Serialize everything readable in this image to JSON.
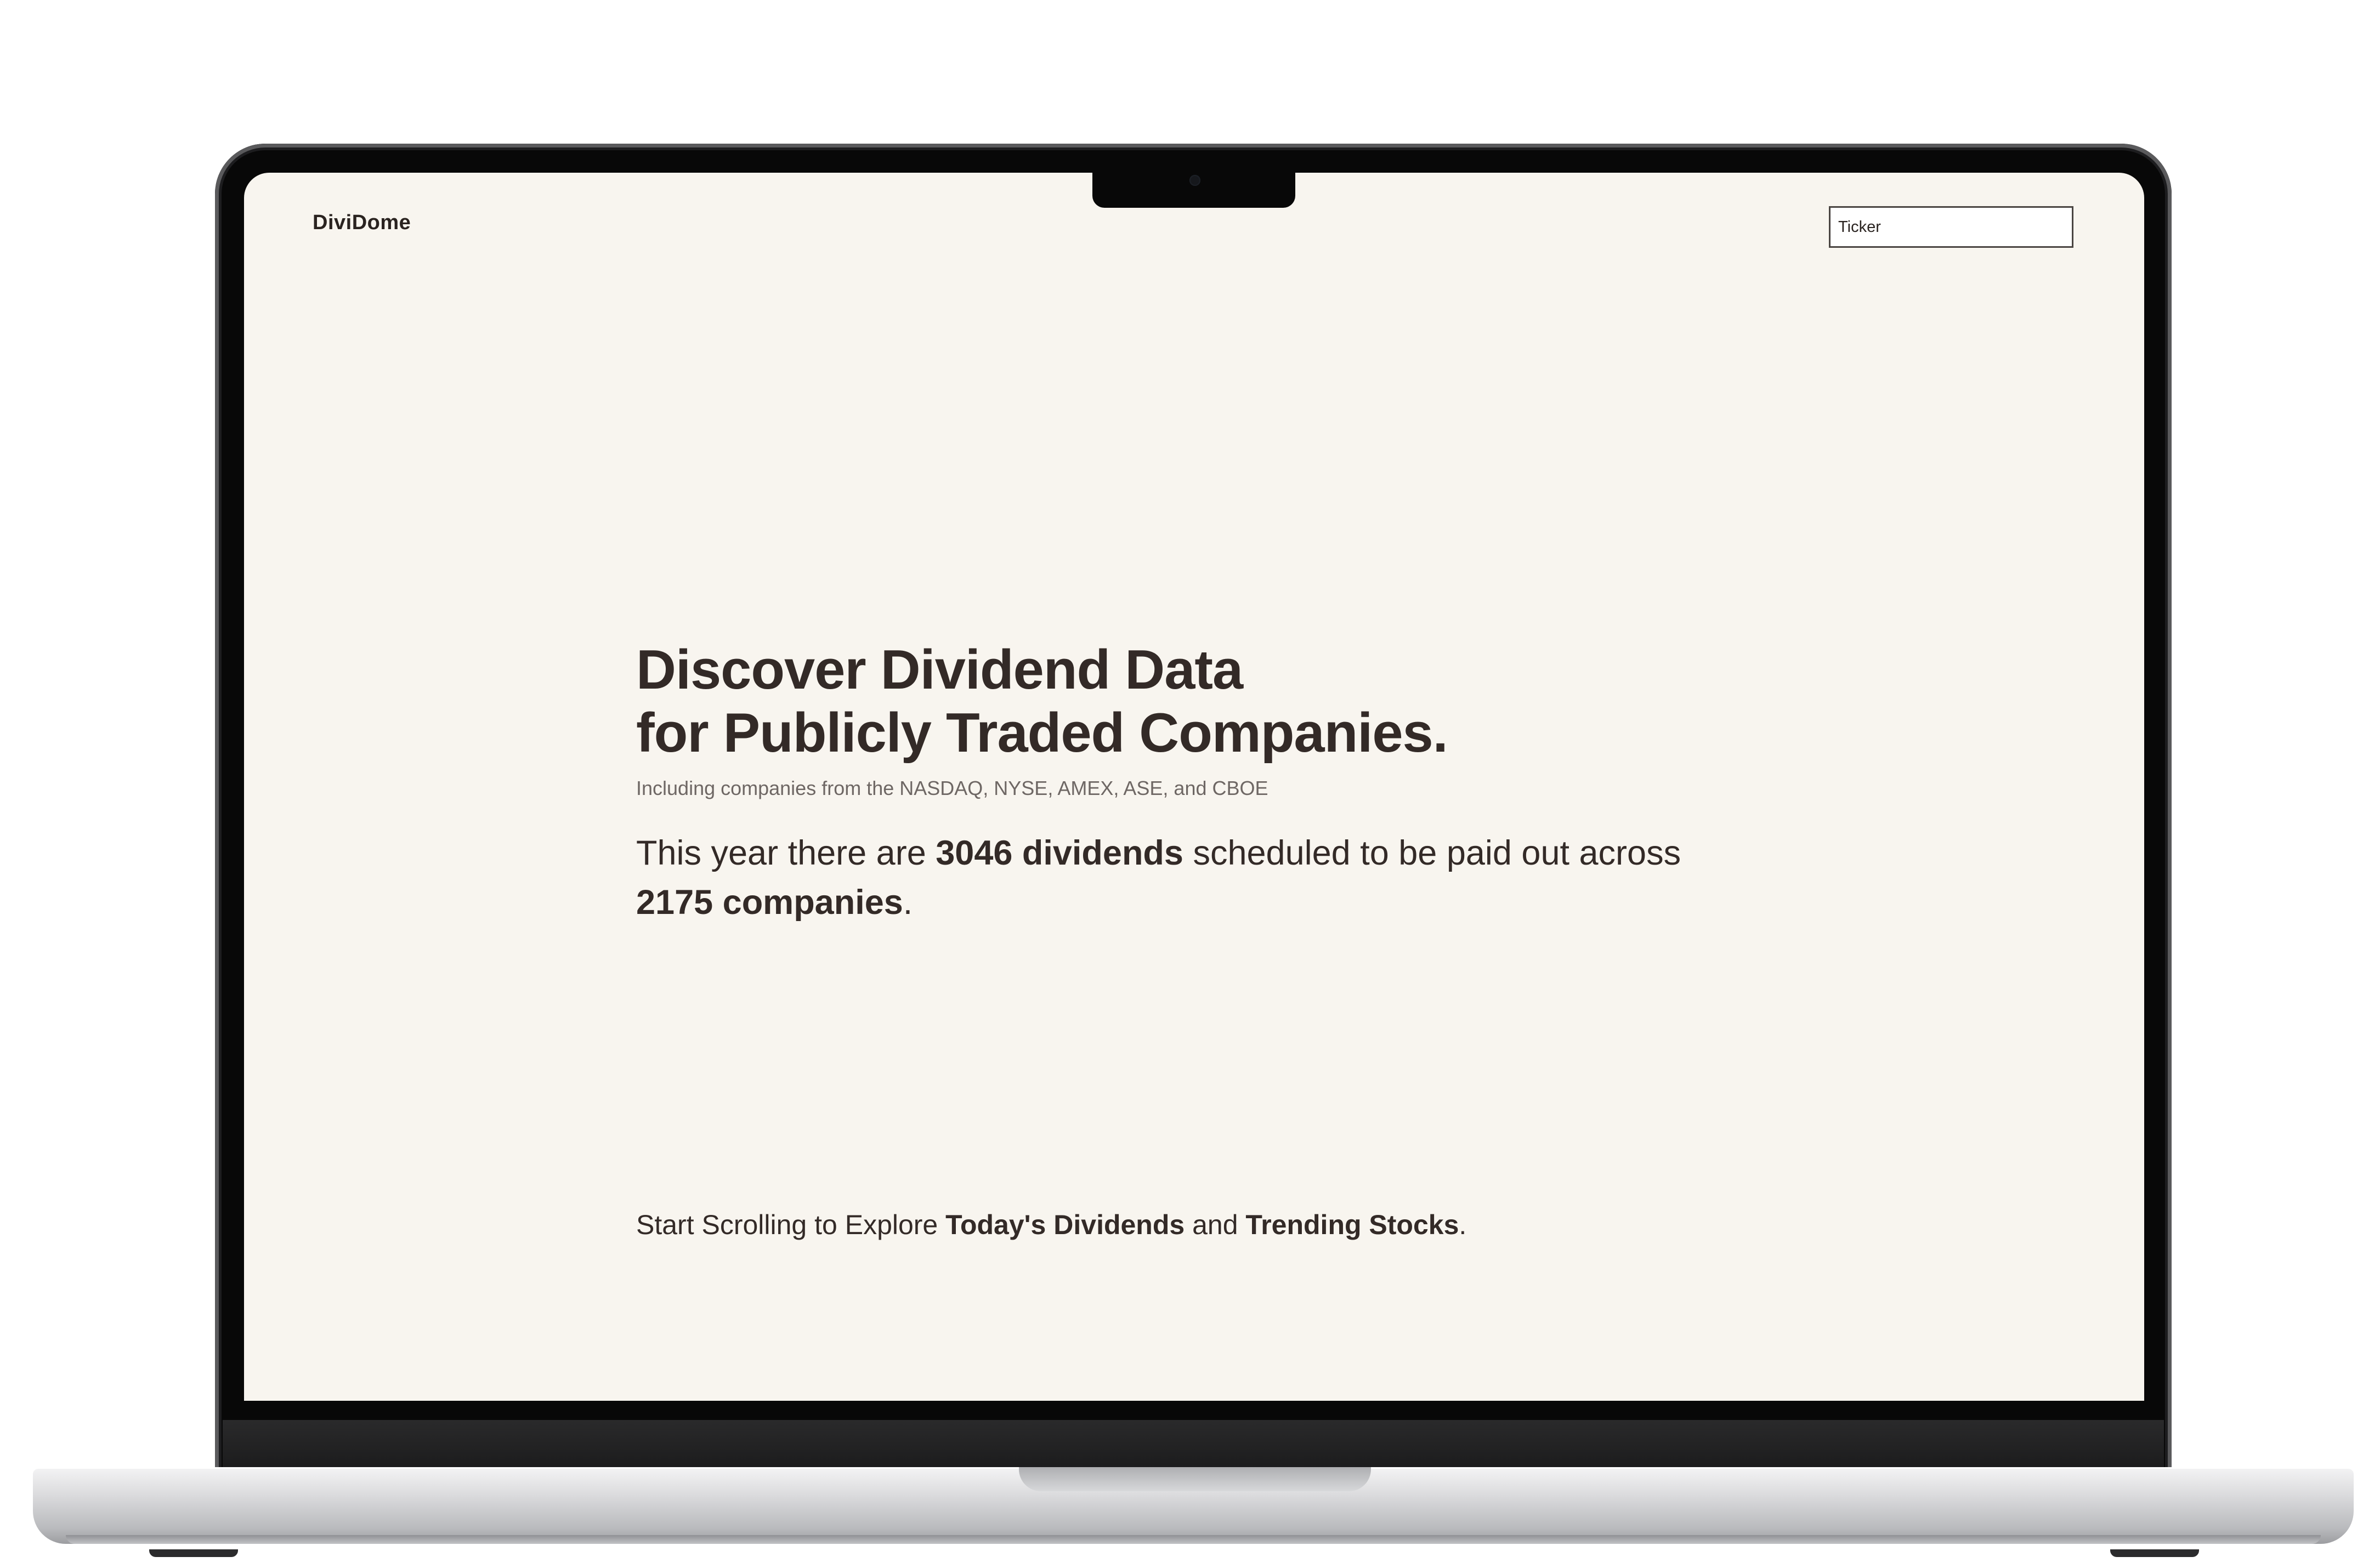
{
  "header": {
    "brand": "DiviDome",
    "search_placeholder": "Ticker"
  },
  "hero": {
    "title_line1": "Discover Dividend Data",
    "title_line2": "for Publicly Traded Companies.",
    "subtitle": "Including companies from the NASDAQ, NYSE, AMEX, ASE, and CBOE",
    "stats": {
      "prefix": "This year there are ",
      "dividends": "3046 dividends",
      "middle": " scheduled to be paid out across ",
      "companies": "2175 companies",
      "suffix": "."
    }
  },
  "explore": {
    "prefix": "Start Scrolling to Explore ",
    "link1": "Today's Dividends",
    "middle": " and ",
    "link2": "Trending Stocks",
    "suffix": "."
  },
  "colors": {
    "page_background": "#f8f5ef",
    "text_primary": "#332a27",
    "text_secondary": "#6e6764"
  }
}
